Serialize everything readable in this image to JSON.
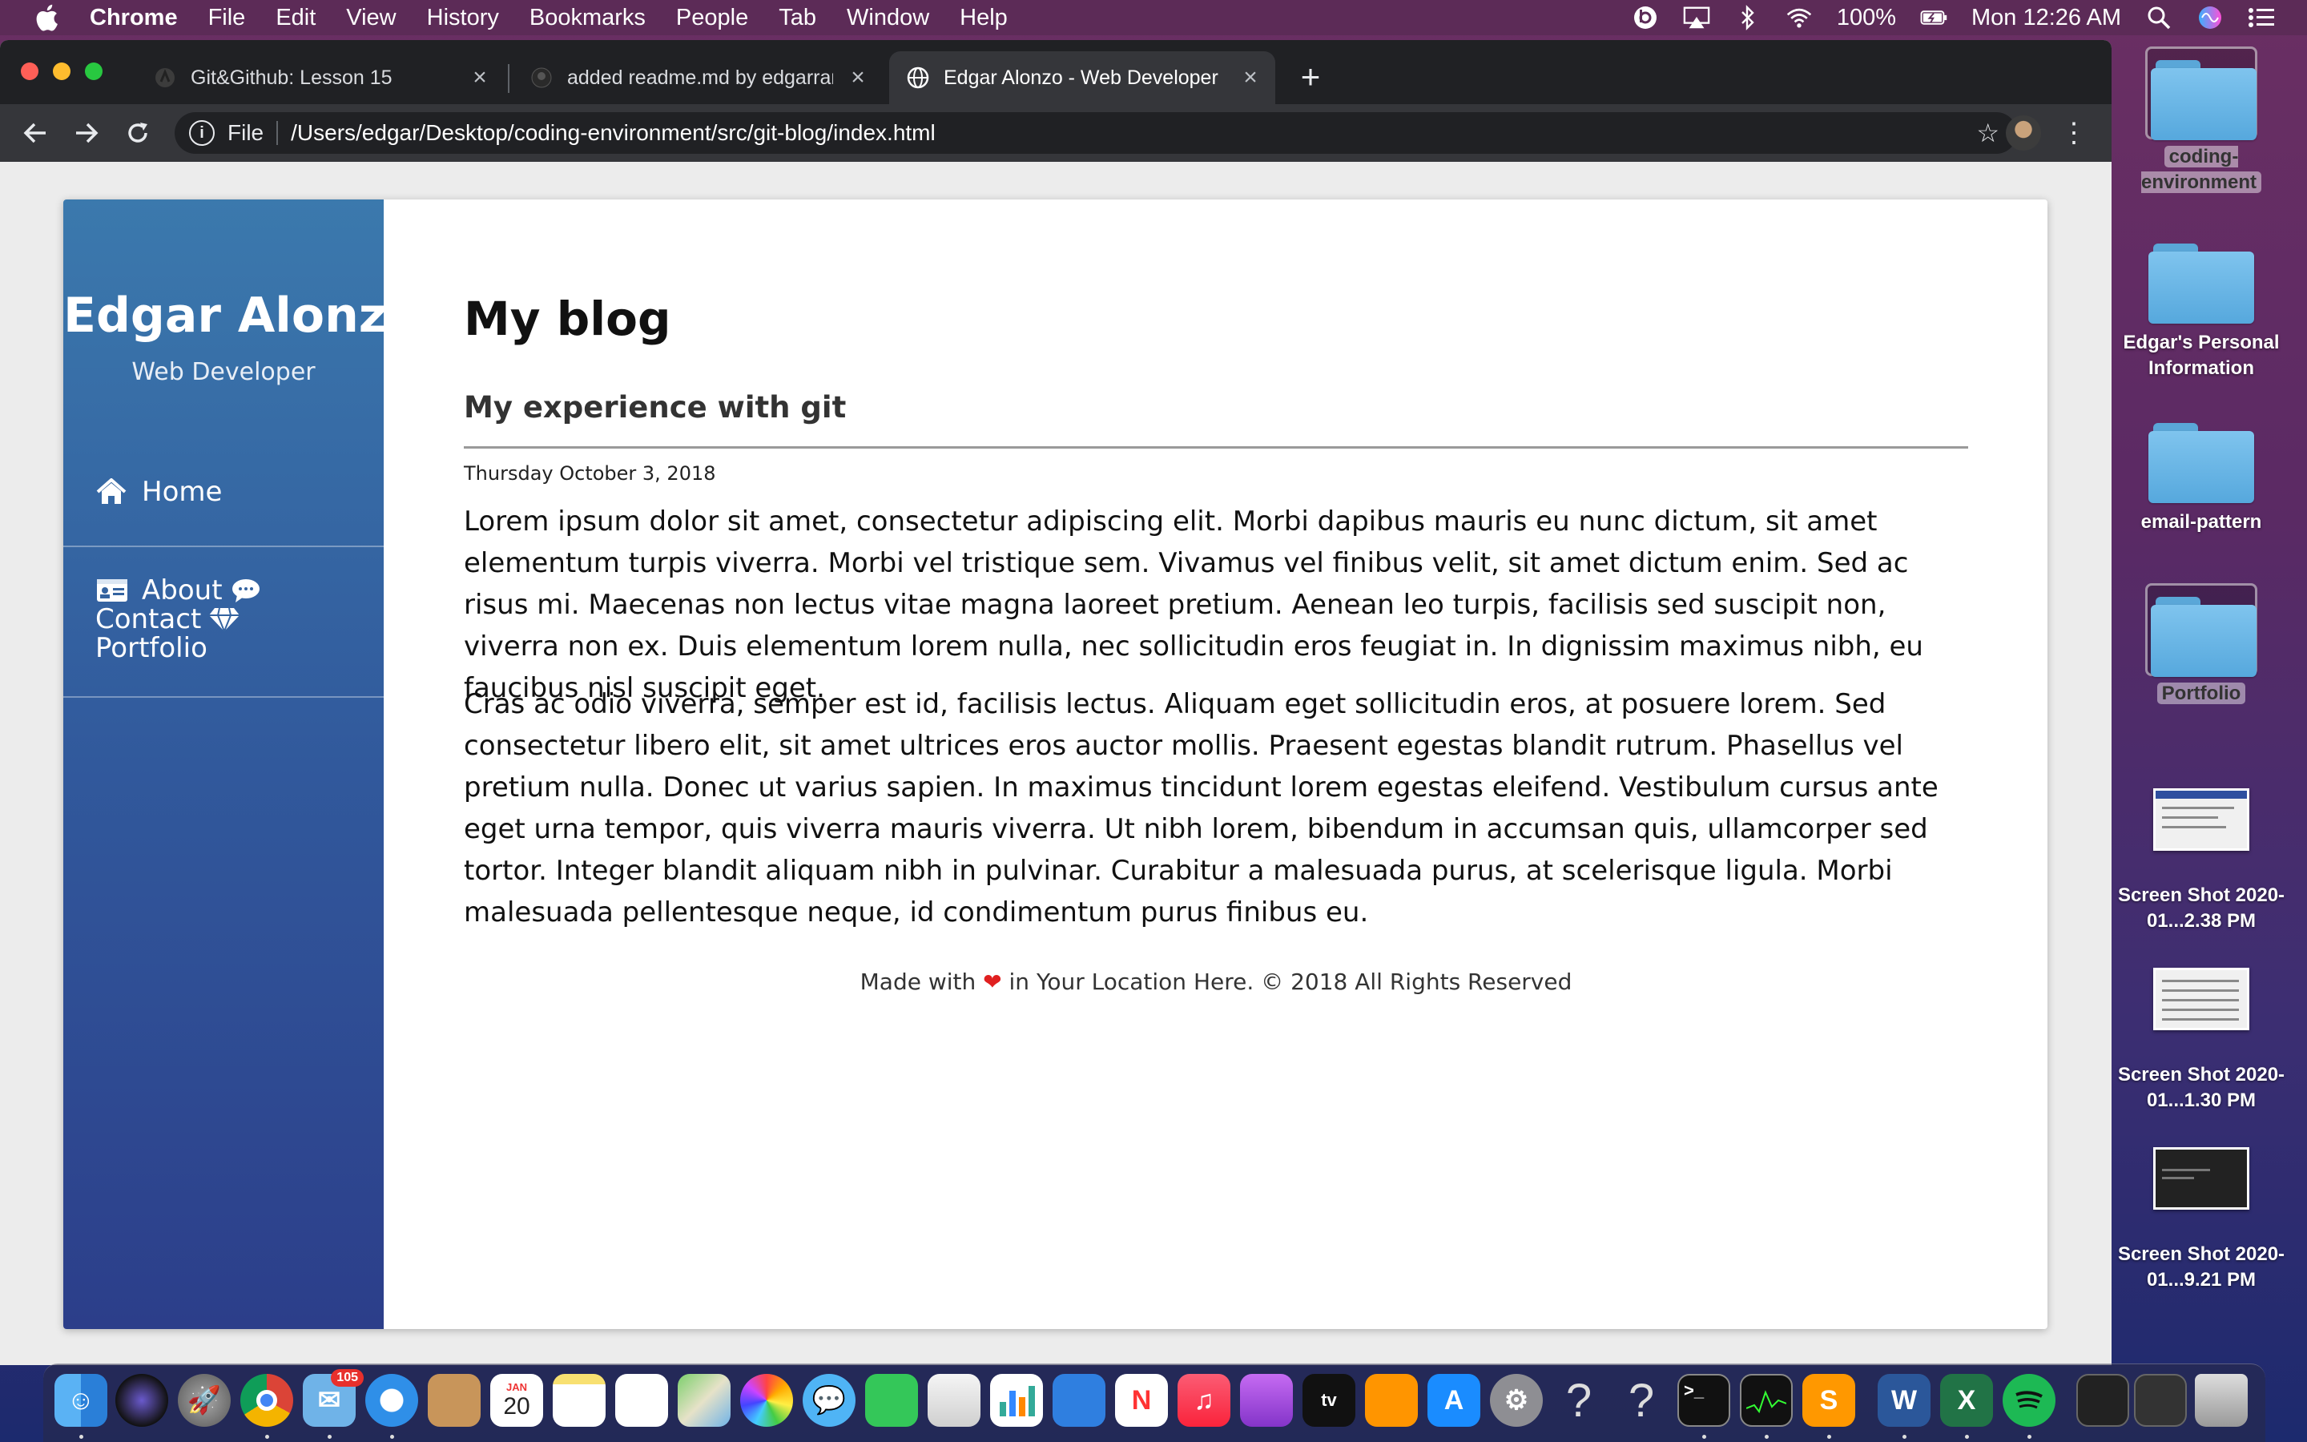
{
  "menubar": {
    "app_name": "Chrome",
    "items": [
      "File",
      "Edit",
      "View",
      "History",
      "Bookmarks",
      "People",
      "Tab",
      "Window",
      "Help"
    ],
    "battery": "100%",
    "clock": "Mon 12:26 AM",
    "icons": [
      "beats-icon",
      "airplay-icon",
      "bluetooth-icon",
      "wifi-icon",
      "battery-icon",
      "spotlight-icon",
      "siri-icon",
      "notification-center-icon"
    ]
  },
  "tabs": [
    {
      "title": "Git&Github: Lesson 15",
      "active": false
    },
    {
      "title": "added readme.md by edgarramb",
      "active": false
    },
    {
      "title": "Edgar Alonzo - Web Developer",
      "active": true
    }
  ],
  "toolbar": {
    "scheme": "File",
    "url": "/Users/edgar/Desktop/coding-environment/src/git-blog/index.html"
  },
  "site": {
    "name": "Edgar Alonzo",
    "role": "Web Developer",
    "nav": {
      "home": "Home",
      "about": "About",
      "contact": "Contact",
      "portfolio": "Portfolio"
    }
  },
  "blog": {
    "heading": "My blog",
    "post_title": "My experience with git",
    "post_date": "Thursday October 3, 2018",
    "paragraphs": [
      "Lorem ipsum dolor sit amet, consectetur adipiscing elit. Morbi dapibus mauris eu nunc dictum, sit amet elementum turpis viverra. Morbi vel tristique sem. Vivamus vel finibus velit, sit amet dictum enim. Sed ac risus mi. Maecenas non lectus vitae magna laoreet pretium. Aenean leo turpis, facilisis sed suscipit non, viverra non ex. Duis elementum lorem nulla, nec sollicitudin eros feugiat in. In dignissim maximus nibh, eu faucibus nisl suscipit eget.",
      "Cras ac odio viverra, semper est id, facilisis lectus. Aliquam eget sollicitudin eros, at posuere lorem. Sed consectetur libero elit, sit amet ultrices eros auctor mollis. Praesent egestas blandit rutrum. Phasellus vel pretium nulla. Donec ut varius sapien. In maximus tincidunt lorem egestas eleifend. Vestibulum cursus ante eget urna tempor, quis viverra mauris viverra. Ut nibh lorem, bibendum in accumsan quis, ullamcorper sed tortor. Integer blandit aliquam nibh in pulvinar. Curabitur a malesuada purus, at scelerisque ligula. Morbi malesuada pellentesque neque, id condimentum purus finibus eu."
    ],
    "footer_before": "Made with",
    "footer_after": "in Your Location Here. © 2018 All Rights Reserved"
  },
  "desktop": {
    "folders": [
      "coding-environment",
      "Edgar's Personal Information",
      "email-pattern",
      "Portfolio"
    ],
    "screenshots": [
      "Screen Shot 2020-01...2.38 PM",
      "Screen Shot 2020-01...1.30 PM",
      "Screen Shot 2020-01...9.21 PM"
    ]
  },
  "dock": {
    "calendar_month": "JAN",
    "calendar_day": "20",
    "mail_badge": "105",
    "apple_tv_label": "tv",
    "apps": [
      "Finder",
      "Siri",
      "Launchpad",
      "Chrome",
      "Mail",
      "Safari",
      "Contacts",
      "Calendar",
      "Notes",
      "Reminders",
      "Maps",
      "Photos",
      "Messages",
      "FaceTime",
      "Preview",
      "Numbers",
      "Keynote",
      "News",
      "Music",
      "Podcasts",
      "TV",
      "Books",
      "App Store",
      "System Preferences",
      "Unknown",
      "Unknown",
      "Terminal",
      "Activity Monitor",
      "Sublime Text",
      "Word",
      "Excel",
      "Spotify",
      "Documents",
      "Downloads",
      "Trash"
    ]
  },
  "colors": {
    "sidebar_top": "#3b79ad",
    "sidebar_bottom": "#2c3e8a",
    "chrome_dark": "#202124",
    "heart": "#e02020"
  }
}
